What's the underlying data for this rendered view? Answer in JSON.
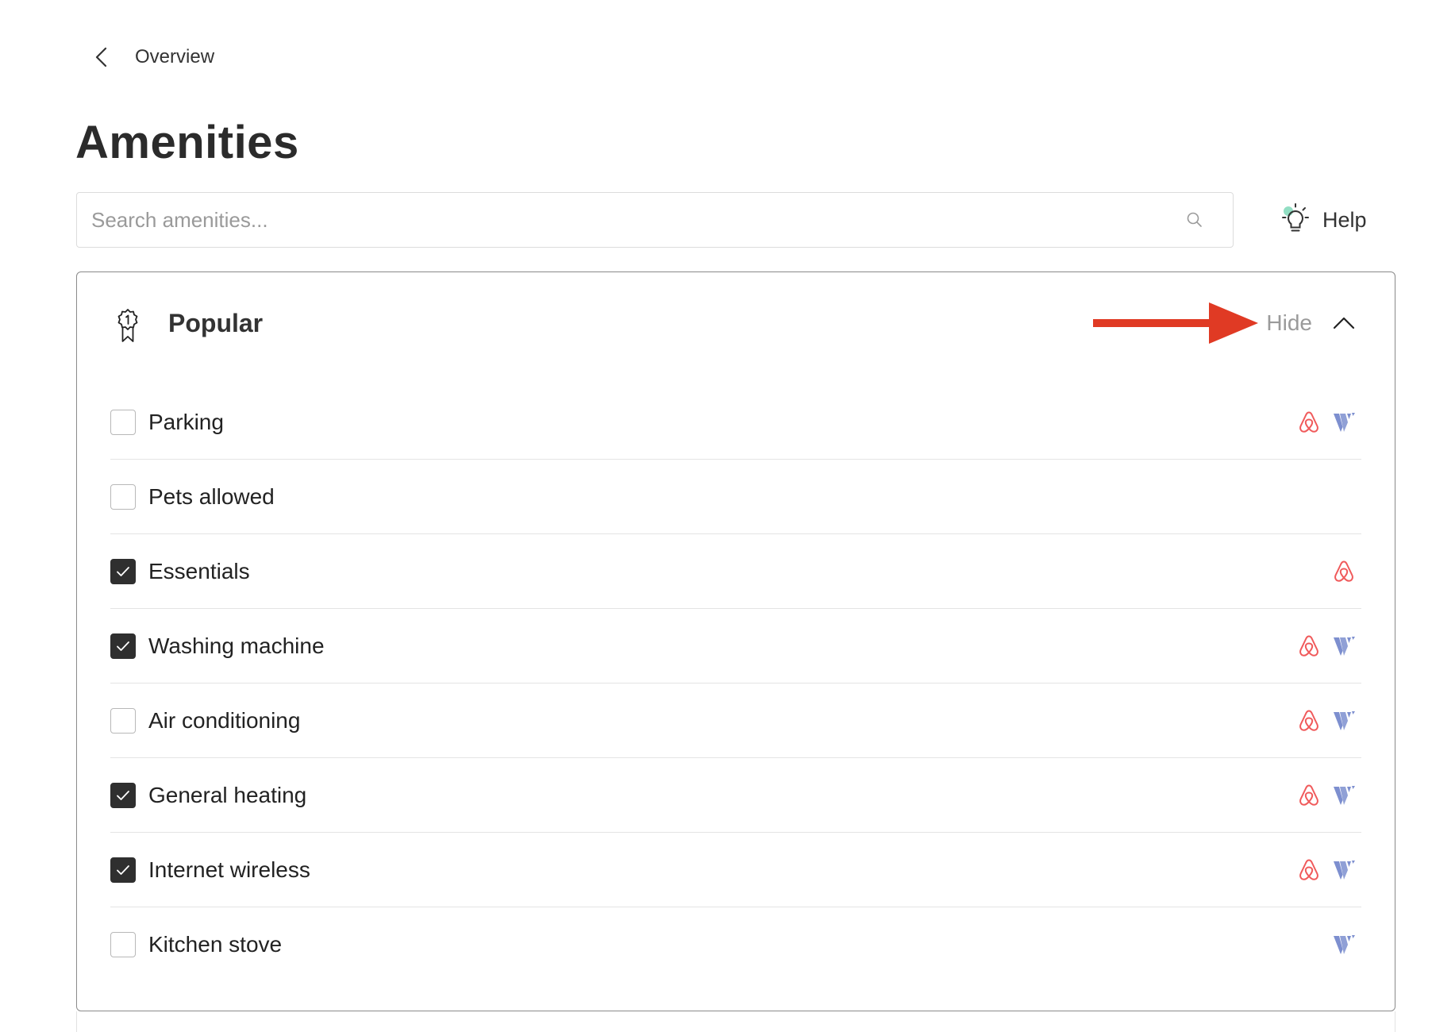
{
  "nav": {
    "back_label": "Overview"
  },
  "page": {
    "title": "Amenities"
  },
  "search": {
    "placeholder": "Search amenities...",
    "value": ""
  },
  "help": {
    "label": "Help"
  },
  "section": {
    "title": "Popular",
    "toggle_label": "Hide",
    "icon": "ribbon-award-icon",
    "toggle_icon": "chevron-up-icon"
  },
  "colors": {
    "airbnb": "#f05a5b",
    "vrbo": "#7d8fcf",
    "annotation_arrow": "#e03a24",
    "checkbox_checked": "#2f2f2f"
  },
  "amenities": [
    {
      "label": "Parking",
      "checked": false,
      "airbnb": true,
      "vrbo": true
    },
    {
      "label": "Pets allowed",
      "checked": false,
      "airbnb": false,
      "vrbo": false
    },
    {
      "label": "Essentials",
      "checked": true,
      "airbnb": true,
      "vrbo": false
    },
    {
      "label": "Washing machine",
      "checked": true,
      "airbnb": true,
      "vrbo": true
    },
    {
      "label": "Air conditioning",
      "checked": false,
      "airbnb": true,
      "vrbo": true
    },
    {
      "label": "General heating",
      "checked": true,
      "airbnb": true,
      "vrbo": true
    },
    {
      "label": "Internet wireless",
      "checked": true,
      "airbnb": true,
      "vrbo": true
    },
    {
      "label": "Kitchen stove",
      "checked": false,
      "airbnb": false,
      "vrbo": true
    }
  ]
}
